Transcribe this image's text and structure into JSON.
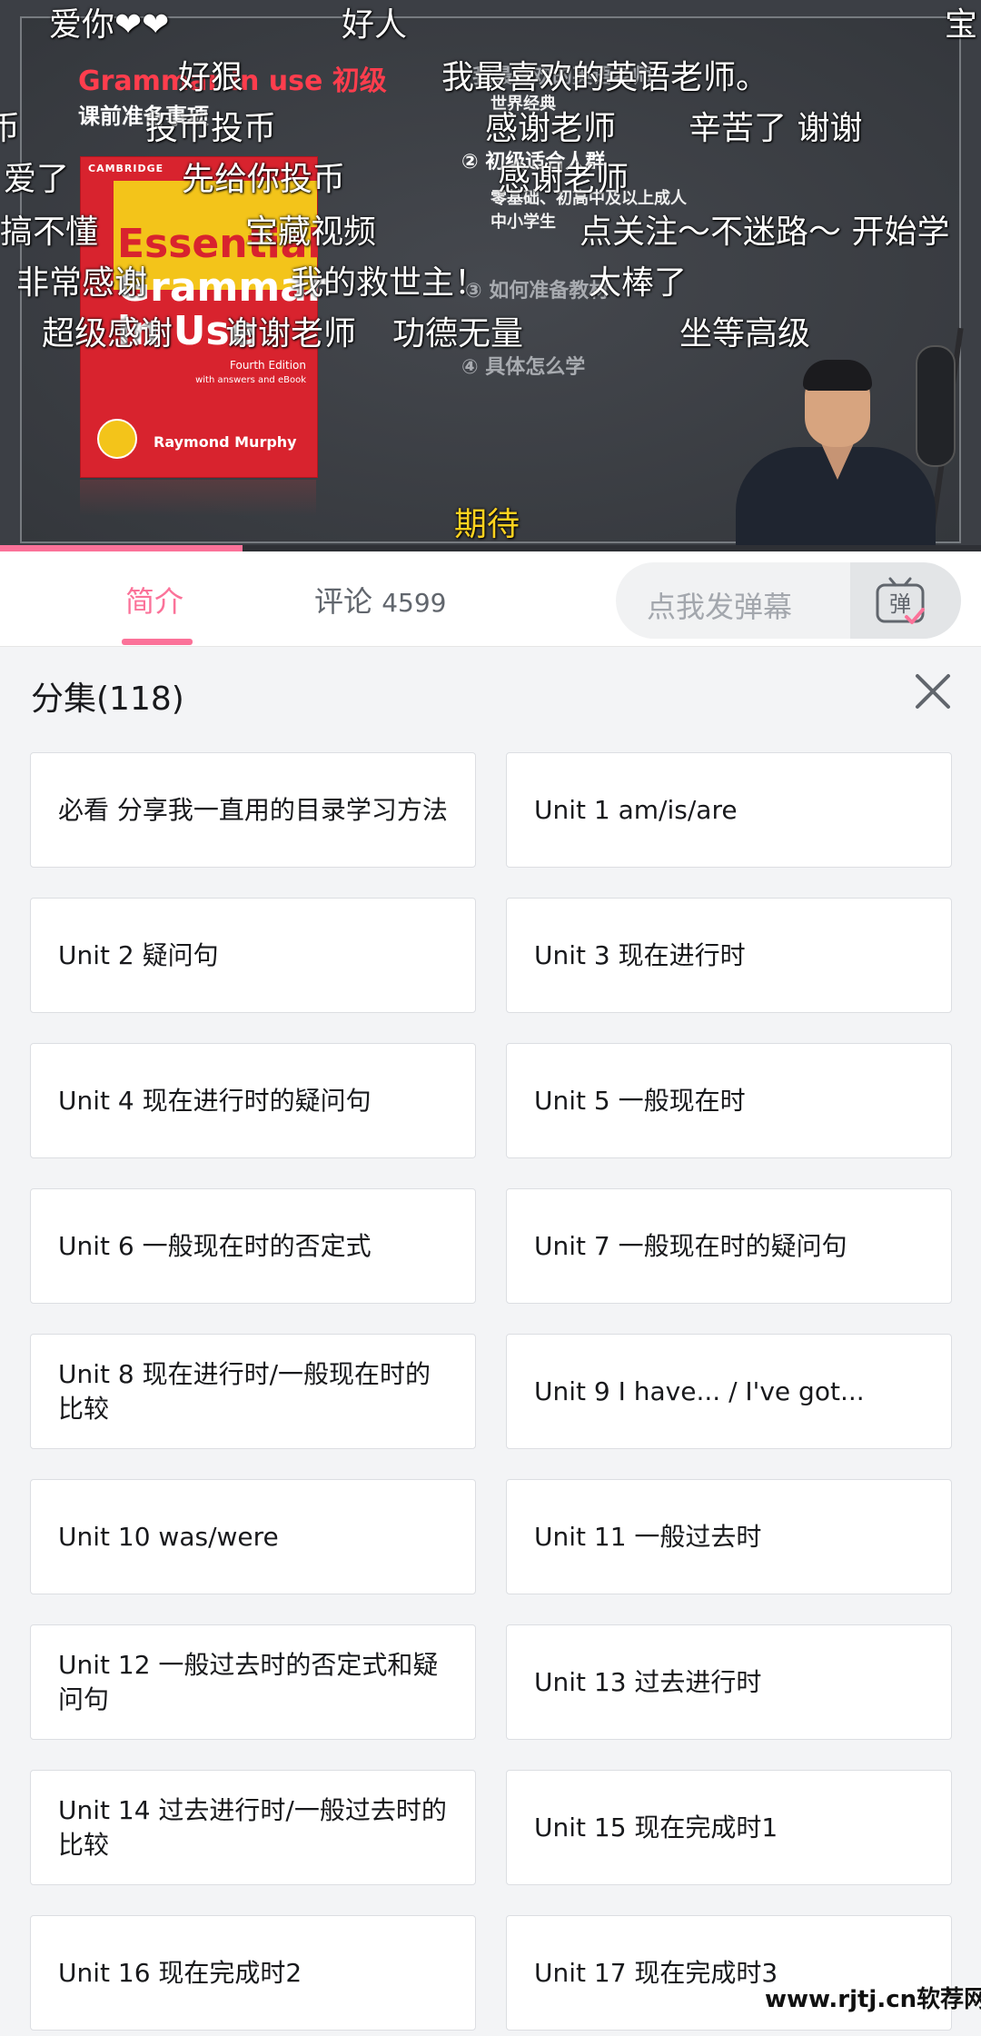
{
  "video": {
    "slide": {
      "title": "Grammar in use 初级",
      "subtitle": "课前准备事项",
      "item1": "我最喜欢的英语老师",
      "note1": "世界经典",
      "item2": "② 初级适合人群",
      "note2": "零基础、初高中及以上成人",
      "note3": "中小学生",
      "item3": "③ 如何准备教材",
      "item4": "④ 具体怎么学"
    },
    "book": {
      "publisher": "CAMBRIDGE",
      "title_line1": "Essential",
      "title_line2": "Grammar",
      "title_line3": "in Use",
      "edition": "Fourth Edition",
      "edition_note": "with answers and eBook",
      "author": "Raymond Murphy"
    },
    "danmaku": [
      "爱你❤❤",
      "好人",
      "宝",
      "好狠",
      "我最喜欢的英语老师。",
      "币",
      "投币投币",
      "感谢老师",
      "辛苦了 谢谢",
      "爱了",
      "先给你投币",
      "感谢老师",
      "搞不懂",
      "宝藏视频",
      "点关注～不迷路～ 开始学",
      "非常感谢",
      "我的救世主！",
      "太棒了",
      "超级感谢",
      "谢谢老师",
      "功德无量",
      "坐等高级",
      "期待"
    ],
    "progress_fraction": 0.247,
    "accent_color": "#fb7299"
  },
  "tabs": {
    "intro": "简介",
    "comments_label": "评论",
    "comments_count": "4599",
    "danmaku_placeholder": "点我发弹幕",
    "danmaku_button": "弹"
  },
  "episodes": {
    "title": "分集(118)",
    "close_icon": "close-icon",
    "items": [
      "必看 分享我一直用的目录学习方法",
      "Unit 1 am/is/are",
      "Unit 2 疑问句",
      "Unit 3 现在进行时",
      "Unit 4 现在进行时的疑问句",
      "Unit 5 一般现在时",
      "Unit 6 一般现在时的否定式",
      "Unit 7 一般现在时的疑问句",
      "Unit 8 现在进行时/一般现在时的比较",
      "Unit 9 I have... / I've got...",
      "Unit 10 was/were",
      "Unit 11 一般过去时",
      "Unit 12 一般过去时的否定式和疑问句",
      "Unit 13 过去进行时",
      "Unit 14 过去进行时/一般过去时的比较",
      "Unit 15 现在完成时1",
      "Unit 16 现在完成时2",
      "Unit 17 现在完成时3"
    ]
  },
  "watermark": "www.rjtj.cn软荐网"
}
